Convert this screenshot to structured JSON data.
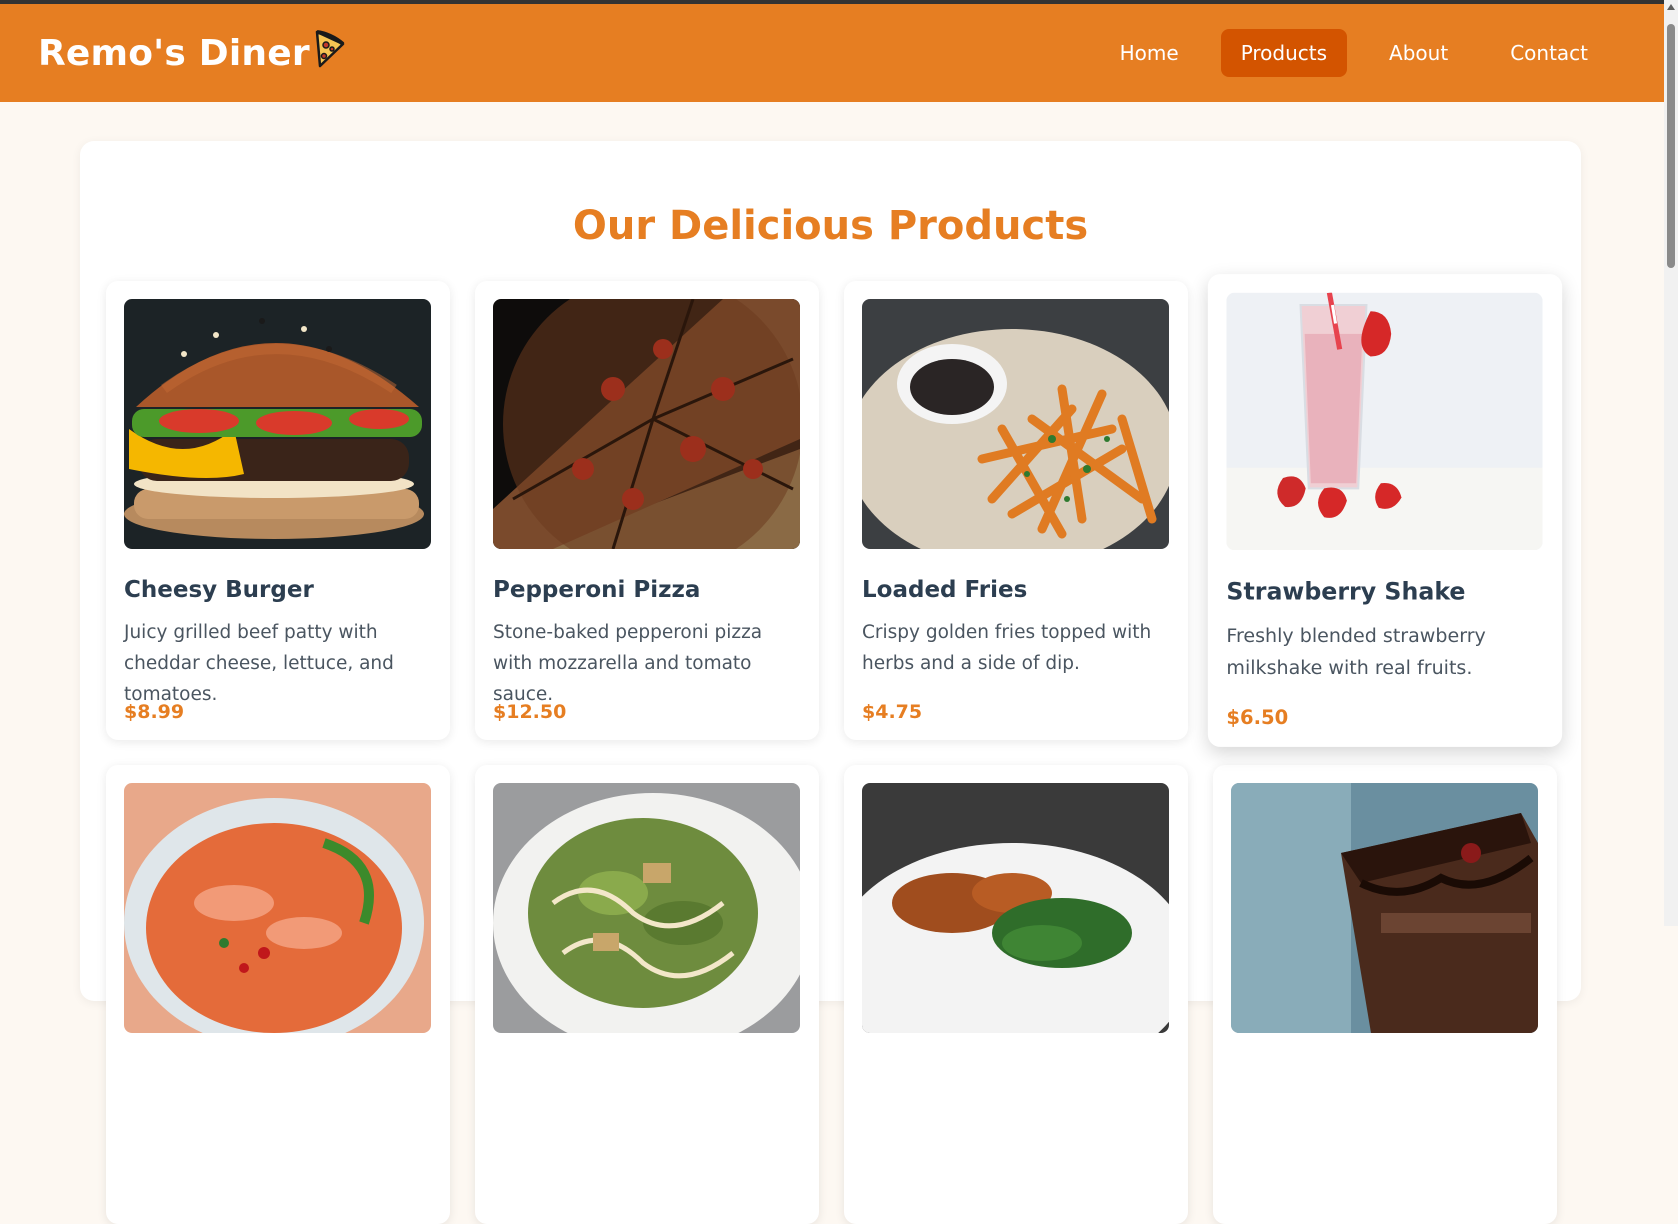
{
  "brand": {
    "name": "Remo's Diner",
    "logo_icon": "pizza-slice-icon"
  },
  "nav": {
    "items": [
      {
        "label": "Home",
        "active": false
      },
      {
        "label": "Products",
        "active": true
      },
      {
        "label": "About",
        "active": false
      },
      {
        "label": "Contact",
        "active": false
      }
    ]
  },
  "main": {
    "title": "Our Delicious Products",
    "products": [
      {
        "name": "Cheesy Burger",
        "description": "Juicy grilled beef patty with cheddar cheese, lettuce, and tomatoes.",
        "price": "$8.99",
        "image": "burger-image"
      },
      {
        "name": "Pepperoni Pizza",
        "description": "Stone-baked pepperoni pizza with mozzarella and tomato sauce.",
        "price": "$12.50",
        "image": "pizza-image"
      },
      {
        "name": "Loaded Fries",
        "description": "Crispy golden fries topped with herbs and a side of dip.",
        "price": "$4.75",
        "image": "fries-image"
      },
      {
        "name": "Strawberry Shake",
        "description": "Freshly blended strawberry milkshake with real fruits.",
        "price": "$6.50",
        "image": "shake-image"
      }
    ],
    "second_row_images": [
      "ramen-bowl-image",
      "caesar-salad-image",
      "grilled-chicken-image",
      "chocolate-cake-image"
    ]
  },
  "colors": {
    "accent": "#e67e22",
    "accent_dark": "#d35400",
    "text": "#2c3e50",
    "background": "#fdf8f2"
  }
}
